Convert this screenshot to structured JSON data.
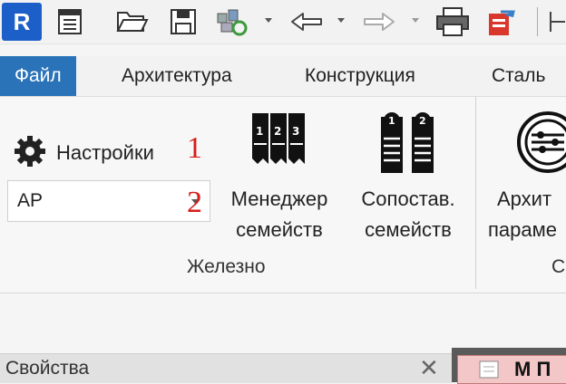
{
  "quick_access": {
    "app_logo": "R",
    "icons": [
      "properties-icon",
      "open-icon",
      "save-icon",
      "sync-icon",
      "undo-icon",
      "redo-icon",
      "print-icon",
      "export-icon"
    ]
  },
  "tabs": [
    {
      "label": "Файл",
      "active": true
    },
    {
      "label": "Архитектура",
      "active": false
    },
    {
      "label": "Конструкция",
      "active": false
    },
    {
      "label": "Сталь",
      "active": false
    }
  ],
  "panel": {
    "settings_label": "Настройки",
    "combo_value": "АР",
    "marker_1": "1",
    "marker_2": "2",
    "family_manager": {
      "line1": "Менеджер",
      "line2": "семейств"
    },
    "family_compare": {
      "line1": "Сопостав.",
      "line2": "семейств"
    },
    "arch_params": {
      "line1": "Архит",
      "line2": "параме"
    },
    "group_label": "Железно",
    "group_label_cut": "С"
  },
  "properties": {
    "title": "Свойства",
    "close": "✕"
  },
  "doc_tab": {
    "label": "М П"
  },
  "colors": {
    "active_tab": "#2a73b8",
    "marker": "#d81b1b",
    "logo": "#1d5fc8"
  }
}
